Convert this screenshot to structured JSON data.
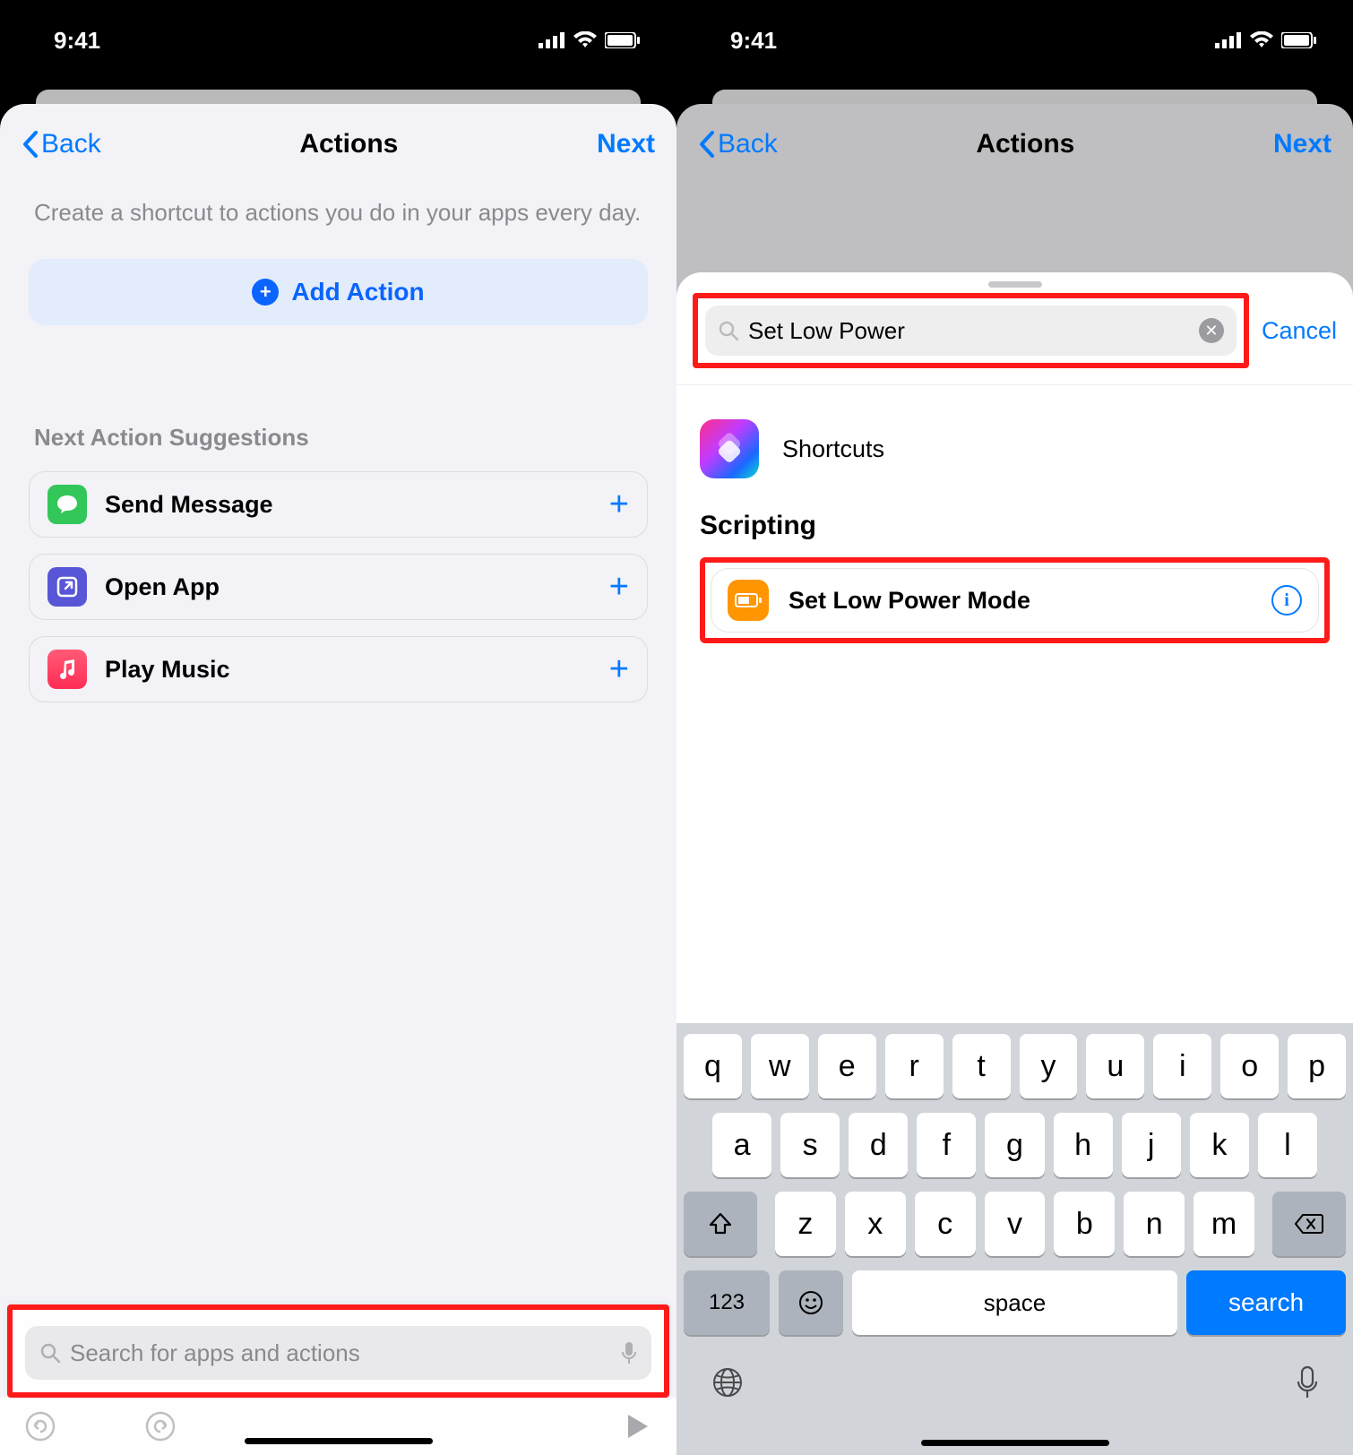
{
  "status": {
    "time": "9:41"
  },
  "left": {
    "nav": {
      "back": "Back",
      "title": "Actions",
      "next": "Next"
    },
    "description": "Create a shortcut to actions you do in your apps every day.",
    "add_action": "Add Action",
    "suggestions_title": "Next Action Suggestions",
    "suggestions": [
      {
        "label": "Send Message",
        "icon": "message",
        "color": "#33c759"
      },
      {
        "label": "Open App",
        "icon": "open",
        "color": "#5856d6"
      },
      {
        "label": "Play Music",
        "icon": "music",
        "color": "#ff3b5c"
      }
    ],
    "search_placeholder": "Search for apps and actions"
  },
  "right": {
    "nav": {
      "back": "Back",
      "title": "Actions",
      "next": "Next"
    },
    "search_value": "Set Low Power",
    "cancel": "Cancel",
    "app_label": "Shortcuts",
    "group_title": "Scripting",
    "action_label": "Set Low Power Mode"
  },
  "keyboard": {
    "row1": [
      "q",
      "w",
      "e",
      "r",
      "t",
      "y",
      "u",
      "i",
      "o",
      "p"
    ],
    "row2": [
      "a",
      "s",
      "d",
      "f",
      "g",
      "h",
      "j",
      "k",
      "l"
    ],
    "row3": [
      "z",
      "x",
      "c",
      "v",
      "b",
      "n",
      "m"
    ],
    "num": "123",
    "space": "space",
    "search": "search"
  }
}
